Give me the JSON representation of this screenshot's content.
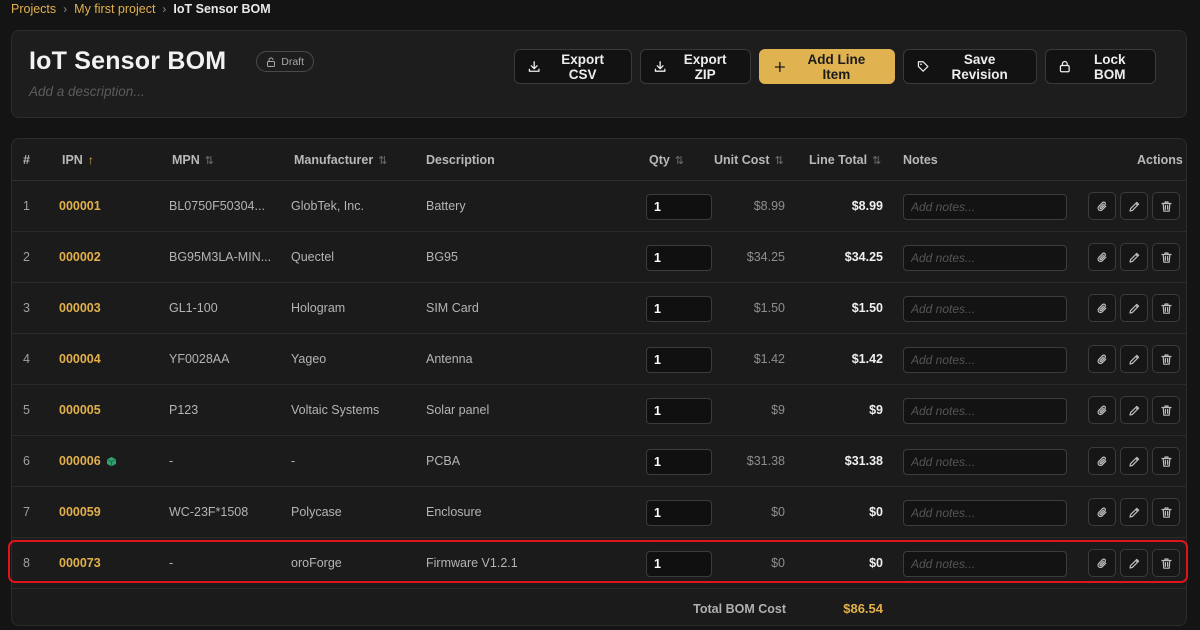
{
  "breadcrumb": {
    "items": [
      "Projects",
      "My first project"
    ],
    "current": "IoT Sensor BOM",
    "separator": "›"
  },
  "header": {
    "title": "IoT Sensor BOM",
    "badge": "Draft",
    "description_placeholder": "Add a description..."
  },
  "toolbar": {
    "export_csv": "Export CSV",
    "export_zip": "Export ZIP",
    "add_line_item": "Add Line Item",
    "save_revision": "Save Revision",
    "lock_bom": "Lock BOM"
  },
  "table": {
    "columns": {
      "num": "#",
      "ipn": "IPN",
      "mpn": "MPN",
      "manufacturer": "Manufacturer",
      "description": "Description",
      "qty": "Qty",
      "unit_cost": "Unit Cost",
      "line_total": "Line Total",
      "notes": "Notes",
      "actions": "Actions"
    },
    "notes_placeholder": "Add notes...",
    "rows": [
      {
        "num": "1",
        "ipn": "000001",
        "mpn": "BL0750F50304...",
        "manufacturer": "GlobTek, Inc.",
        "description": "Battery",
        "qty": "1",
        "unit_cost": "$8.99",
        "line_total": "$8.99"
      },
      {
        "num": "2",
        "ipn": "000002",
        "mpn": "BG95M3LA-MIN...",
        "manufacturer": "Quectel",
        "description": "BG95",
        "qty": "1",
        "unit_cost": "$34.25",
        "line_total": "$34.25"
      },
      {
        "num": "3",
        "ipn": "000003",
        "mpn": "GL1-100",
        "manufacturer": "Hologram",
        "description": "SIM Card",
        "qty": "1",
        "unit_cost": "$1.50",
        "line_total": "$1.50"
      },
      {
        "num": "4",
        "ipn": "000004",
        "mpn": "YF0028AA",
        "manufacturer": "Yageo",
        "description": "Antenna",
        "qty": "1",
        "unit_cost": "$1.42",
        "line_total": "$1.42"
      },
      {
        "num": "5",
        "ipn": "000005",
        "mpn": "P123",
        "manufacturer": "Voltaic Systems",
        "description": "Solar panel",
        "qty": "1",
        "unit_cost": "$9",
        "line_total": "$9"
      },
      {
        "num": "6",
        "ipn": "000006",
        "mpn": "-",
        "manufacturer": "-",
        "description": "PCBA",
        "qty": "1",
        "unit_cost": "$31.38",
        "line_total": "$31.38"
      },
      {
        "num": "7",
        "ipn": "000059",
        "mpn": "WC-23F*1508",
        "manufacturer": "Polycase",
        "description": "Enclosure",
        "qty": "1",
        "unit_cost": "$0",
        "line_total": "$0"
      },
      {
        "num": "8",
        "ipn": "000073",
        "mpn": "-",
        "manufacturer": "oroForge",
        "description": "Firmware V1.2.1",
        "qty": "1",
        "unit_cost": "$0",
        "line_total": "$0"
      }
    ],
    "footer": {
      "label": "Total BOM Cost",
      "total": "$86.54"
    }
  },
  "colors": {
    "accent": "#e0b350",
    "highlight": "#e0151c",
    "assembly_icon": "#2fa36b"
  },
  "icons": {
    "row_actions": [
      "paperclip-icon",
      "pencil-icon",
      "trash-icon"
    ],
    "assembly": "cube-icon"
  }
}
